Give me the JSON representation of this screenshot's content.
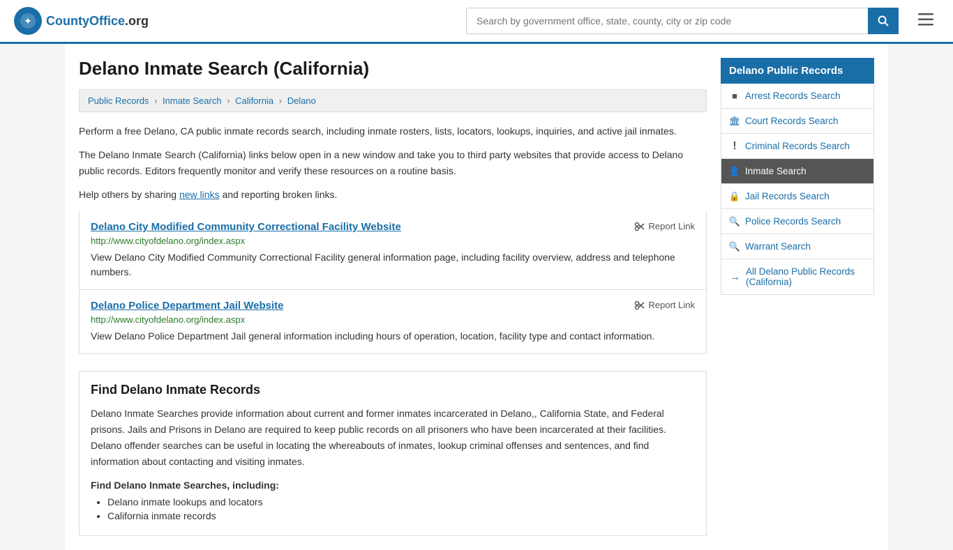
{
  "header": {
    "logo_text": "CountyOffice",
    "logo_suffix": ".org",
    "search_placeholder": "Search by government office, state, county, city or zip code",
    "search_value": ""
  },
  "page": {
    "title": "Delano Inmate Search (California)",
    "breadcrumbs": [
      {
        "label": "Public Records",
        "href": "#"
      },
      {
        "label": "Inmate Search",
        "href": "#"
      },
      {
        "label": "California",
        "href": "#"
      },
      {
        "label": "Delano",
        "href": "#"
      }
    ],
    "description1": "Perform a free Delano, CA public inmate records search, including inmate rosters, lists, locators, lookups, inquiries, and active jail inmates.",
    "description2": "The Delano Inmate Search (California) links below open in a new window and take you to third party websites that provide access to Delano public records. Editors frequently monitor and verify these resources on a routine basis.",
    "description3_prefix": "Help others by sharing ",
    "description3_link": "new links",
    "description3_suffix": " and reporting broken links.",
    "links": [
      {
        "title": "Delano City Modified Community Correctional Facility Website",
        "url": "http://www.cityofdelano.org/index.aspx",
        "description": "View Delano City Modified Community Correctional Facility general information page, including facility overview, address and telephone numbers.",
        "report_label": "Report Link"
      },
      {
        "title": "Delano Police Department Jail Website",
        "url": "http://www.cityofdelano.org/index.aspx",
        "description": "View Delano Police Department Jail general information including hours of operation, location, facility type and contact information.",
        "report_label": "Report Link"
      }
    ],
    "find_section": {
      "title": "Find Delano Inmate Records",
      "description": "Delano Inmate Searches provide information about current and former inmates incarcerated in Delano,, California State, and Federal prisons. Jails and Prisons in Delano are required to keep public records on all prisoners who have been incarcerated at their facilities. Delano offender searches can be useful in locating the whereabouts of inmates, lookup criminal offenses and sentences, and find information about contacting and visiting inmates.",
      "sub_heading": "Find Delano Inmate Searches, including:",
      "list_items": [
        "Delano inmate lookups and locators",
        "California inmate records"
      ]
    }
  },
  "sidebar": {
    "title": "Delano Public Records",
    "items": [
      {
        "label": "Arrest Records Search",
        "icon": "■",
        "active": false
      },
      {
        "label": "Court Records Search",
        "icon": "🏛",
        "active": false
      },
      {
        "label": "Criminal Records Search",
        "icon": "!",
        "active": false
      },
      {
        "label": "Inmate Search",
        "icon": "👤",
        "active": true
      },
      {
        "label": "Jail Records Search",
        "icon": "🔒",
        "active": false
      },
      {
        "label": "Police Records Search",
        "icon": "🔍",
        "active": false
      },
      {
        "label": "Warrant Search",
        "icon": "🔍",
        "active": false
      }
    ],
    "all_link": "All Delano Public Records (California)"
  }
}
